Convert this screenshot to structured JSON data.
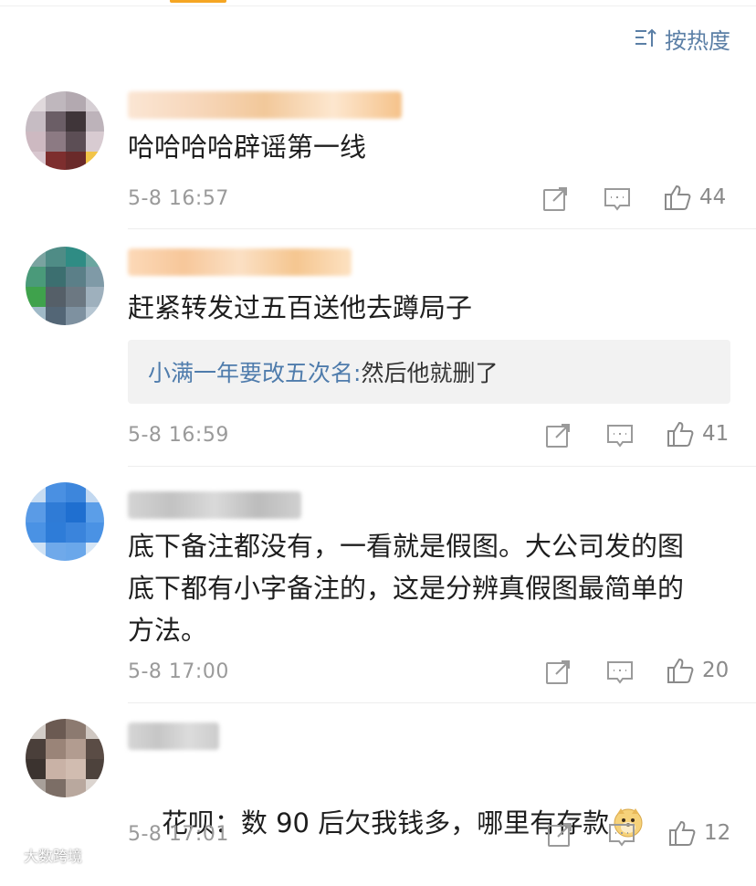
{
  "sort": {
    "label": "按热度",
    "icon": "sort-list-icon"
  },
  "comments": [
    {
      "text": "哈哈哈哈辟谣第一线",
      "time": "5-8 16:57",
      "likes": "44"
    },
    {
      "text": "赶紧转发过五百送他去蹲局子",
      "reply": {
        "author": "小满一年要改五次名:",
        "text": " 然后他就删了"
      },
      "time": "5-8 16:59",
      "likes": "41"
    },
    {
      "text": "底下备注都没有，一看就是假图。大公司发的图\n底下都有小字备注的，这是分辨真假图最简单的\n方法。",
      "time": "5-8 17:00",
      "likes": "20"
    },
    {
      "text": "花呗：数 90 后欠我钱多，哪里有存款",
      "emoji": "doge-emoji",
      "time": "5-8 17:01",
      "likes": "12"
    }
  ],
  "icons": {
    "share": "share-icon",
    "comment": "comment-icon",
    "like": "thumbs-up-icon"
  },
  "watermark": "大数跨境",
  "colors": {
    "link": "#4f7cac",
    "sort": "#5b7fa6",
    "meta": "#9a9a9a",
    "reply_bg": "#f2f2f2"
  }
}
